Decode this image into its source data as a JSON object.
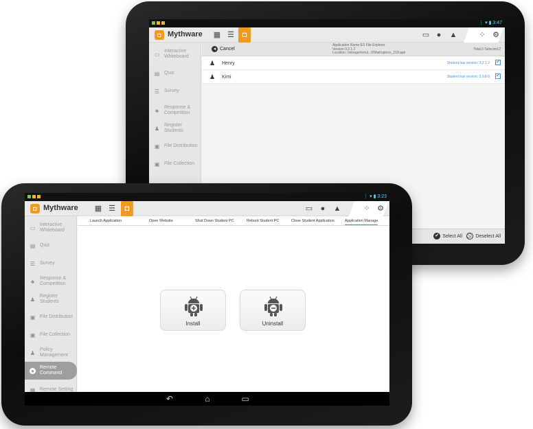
{
  "app": {
    "title": "Mythware",
    "logo_glyph": "◘",
    "status_time_back": "3:47",
    "status_time_front": "3:23",
    "toolbar_icons": [
      "grid-icon",
      "list-icon",
      "orange-app-icon"
    ],
    "right_icons": [
      "monitor-icon",
      "chat-icon",
      "lock-icon",
      "apps-icon",
      "gear-icon"
    ]
  },
  "sidebar": {
    "items": [
      {
        "label": "Interactive Whiteboard",
        "icon": "whiteboard-icon",
        "glyph": "▭"
      },
      {
        "label": "Quiz",
        "icon": "quiz-icon",
        "glyph": "▤"
      },
      {
        "label": "Survey",
        "icon": "survey-icon",
        "glyph": "☰"
      },
      {
        "label": "Response & Competition",
        "icon": "response-icon",
        "glyph": "♣"
      },
      {
        "label": "Register Students",
        "icon": "register-icon",
        "glyph": "♟"
      },
      {
        "label": "File Distribution",
        "icon": "file-distribution-icon",
        "glyph": "▣"
      },
      {
        "label": "File Collection",
        "icon": "file-collection-icon",
        "glyph": "▣"
      },
      {
        "label": "Policy Management",
        "icon": "policy-icon",
        "glyph": "♟"
      },
      {
        "label": "Remote Command",
        "icon": "remote-command-icon",
        "glyph": "●"
      },
      {
        "label": "Remote Setting",
        "icon": "remote-setting-icon",
        "glyph": "▦"
      }
    ]
  },
  "back_screen": {
    "cancel_label": "Cancel",
    "app_info_lines": [
      "Application Name:ES File Explorer",
      "Version:3.2.1.2",
      "Location: /storage/emul...0/Mail/uploos_218.apk"
    ],
    "total_label": "Total:2 Selected:2",
    "students": [
      {
        "name": "Henry",
        "version": "Student has version: 3.2.1.2",
        "checked": "✔"
      },
      {
        "name": "Kimi",
        "version": "Student has version: 3.0.8.0",
        "checked": "✔"
      }
    ],
    "select_all_label": "Select All",
    "deselect_all_label": "Deselect All"
  },
  "front_screen": {
    "tabs": [
      "Launch Application",
      "Open Website",
      "Shut Down Student PC",
      "Reboot Student PC",
      "Close Student Application",
      "Application Manage"
    ],
    "active_tab_index": 5,
    "install_label": "Install",
    "uninstall_label": "Uninstall",
    "nav_buttons": [
      "back-icon",
      "home-icon",
      "recent-apps-icon"
    ]
  },
  "colors": {
    "accent_orange": "#f29a1f",
    "link_blue": "#4a90d9",
    "status_cyan": "#5fd3f3"
  }
}
